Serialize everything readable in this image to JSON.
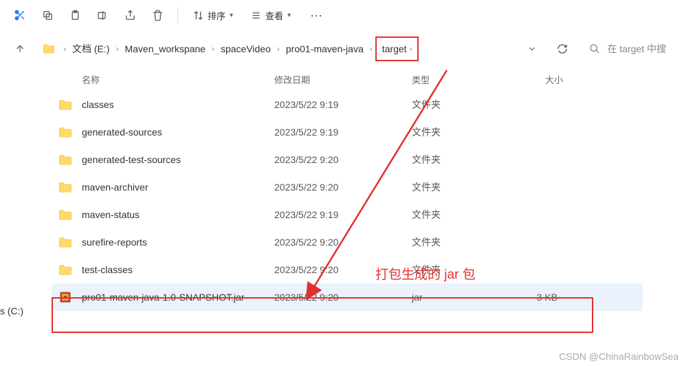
{
  "toolbar": {
    "sort_label": "排序",
    "view_label": "查看"
  },
  "breadcrumb": {
    "segments": [
      "文档 (E:)",
      "Maven_workspane",
      "spaceVideo",
      "pro01-maven-java",
      "target"
    ]
  },
  "search": {
    "placeholder": "在 target 中搜"
  },
  "columns": {
    "name": "名称",
    "date": "修改日期",
    "type": "类型",
    "size": "大小"
  },
  "files": [
    {
      "name": "classes",
      "date": "2023/5/22 9:19",
      "type": "文件夹",
      "size": "",
      "kind": "folder"
    },
    {
      "name": "generated-sources",
      "date": "2023/5/22 9:19",
      "type": "文件夹",
      "size": "",
      "kind": "folder"
    },
    {
      "name": "generated-test-sources",
      "date": "2023/5/22 9:20",
      "type": "文件夹",
      "size": "",
      "kind": "folder"
    },
    {
      "name": "maven-archiver",
      "date": "2023/5/22 9:20",
      "type": "文件夹",
      "size": "",
      "kind": "folder"
    },
    {
      "name": "maven-status",
      "date": "2023/5/22 9:19",
      "type": "文件夹",
      "size": "",
      "kind": "folder"
    },
    {
      "name": "surefire-reports",
      "date": "2023/5/22 9:20",
      "type": "文件夹",
      "size": "",
      "kind": "folder"
    },
    {
      "name": "test-classes",
      "date": "2023/5/22 9:20",
      "type": "文件夹",
      "size": "",
      "kind": "folder"
    },
    {
      "name": "pro01-maven-java-1.0-SNAPSHOT.jar",
      "date": "2023/5/22 9:20",
      "type": "jar",
      "size": "3 KB",
      "kind": "jar",
      "selected": true
    }
  ],
  "annotation": {
    "label": "打包生成的 jar 包"
  },
  "drive": {
    "label": "s (C:)"
  },
  "watermark": "CSDN @ChinaRainbowSea"
}
